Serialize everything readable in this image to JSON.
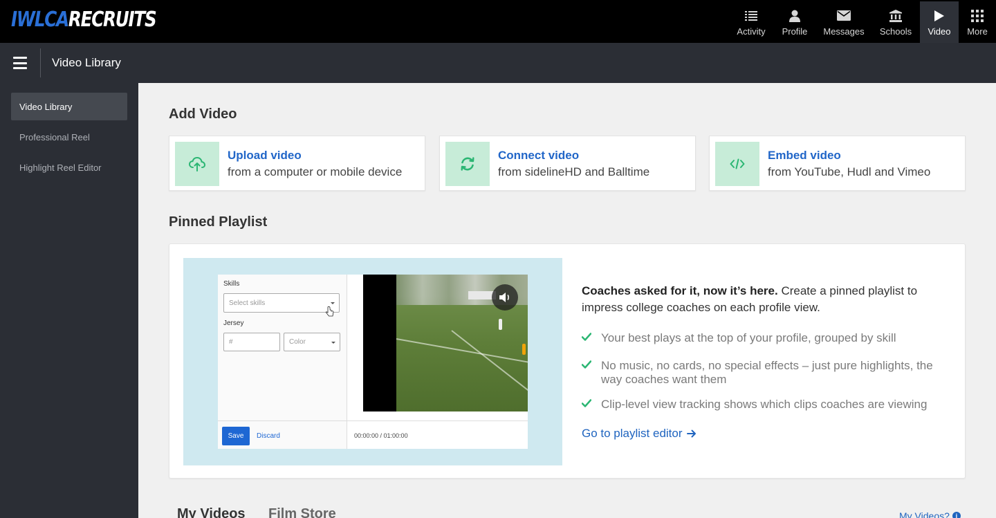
{
  "brand": {
    "logo_part1": "IWLCA",
    "logo_part2": "RECRUITS"
  },
  "nav": {
    "items": [
      {
        "label": "Activity",
        "icon": "list-icon"
      },
      {
        "label": "Profile",
        "icon": "person-icon"
      },
      {
        "label": "Messages",
        "icon": "envelope-icon"
      },
      {
        "label": "Schools",
        "icon": "bank-icon"
      },
      {
        "label": "Video",
        "icon": "play-icon"
      },
      {
        "label": "More",
        "icon": "grid-icon"
      }
    ],
    "active": "Video"
  },
  "subheader": {
    "title": "Video Library"
  },
  "sidebar": {
    "items": [
      {
        "label": "Video Library"
      },
      {
        "label": "Professional Reel"
      },
      {
        "label": "Highlight Reel Editor"
      }
    ],
    "active": "Video Library"
  },
  "add_video": {
    "heading": "Add Video",
    "cards": [
      {
        "title": "Upload video",
        "subtitle": "from a computer or mobile device",
        "icon": "cloud-upload-icon"
      },
      {
        "title": "Connect video",
        "subtitle": "from sidelineHD and Balltime",
        "icon": "sync-icon"
      },
      {
        "title": "Embed video",
        "subtitle": "from YouTube, Hudl and Vimeo",
        "icon": "code-icon"
      }
    ]
  },
  "pinned": {
    "heading": "Pinned Playlist",
    "intro_bold": "Coaches asked for it, now it’s here.",
    "intro_rest": " Create a pinned playlist to impress college coaches on each profile view.",
    "bullets": [
      "Your best plays at the top of your profile, grouped by skill",
      "No music, no cards, no special effects – just pure highlights, the way coaches want them",
      "Clip-level view tracking shows which clips coaches are viewing"
    ],
    "link_label": "Go to playlist editor",
    "preview": {
      "skills_label": "Skills",
      "skills_placeholder": "Select skills",
      "jersey_label": "Jersey",
      "number_placeholder": "#",
      "color_placeholder": "Color",
      "save_label": "Save",
      "discard_label": "Discard",
      "time": "00:00:00 / 01:00:00"
    }
  },
  "tabs": {
    "my_videos": "My Videos",
    "film_store": "Film Store",
    "help_link": "My Videos?"
  },
  "colors": {
    "accent_blue": "#2166c8",
    "icon_green": "#2bb673",
    "icon_bg": "#c7ecd8",
    "sidebar_bg": "#2b2e35"
  }
}
